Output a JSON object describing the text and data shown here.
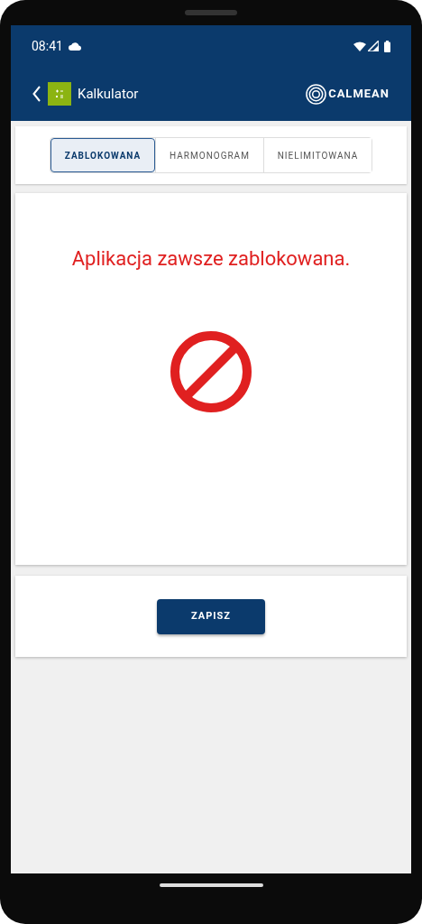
{
  "status_bar": {
    "time": "08:41"
  },
  "app_bar": {
    "title": "Kalkulator",
    "brand": "CALMEAN"
  },
  "tabs": [
    {
      "label": "ZABLOKOWANA",
      "selected": true
    },
    {
      "label": "HARMONOGRAM",
      "selected": false
    },
    {
      "label": "NIELIMITOWANA",
      "selected": false
    }
  ],
  "message": "Aplikacja zawsze zablokowana.",
  "save_button": "ZAPISZ"
}
